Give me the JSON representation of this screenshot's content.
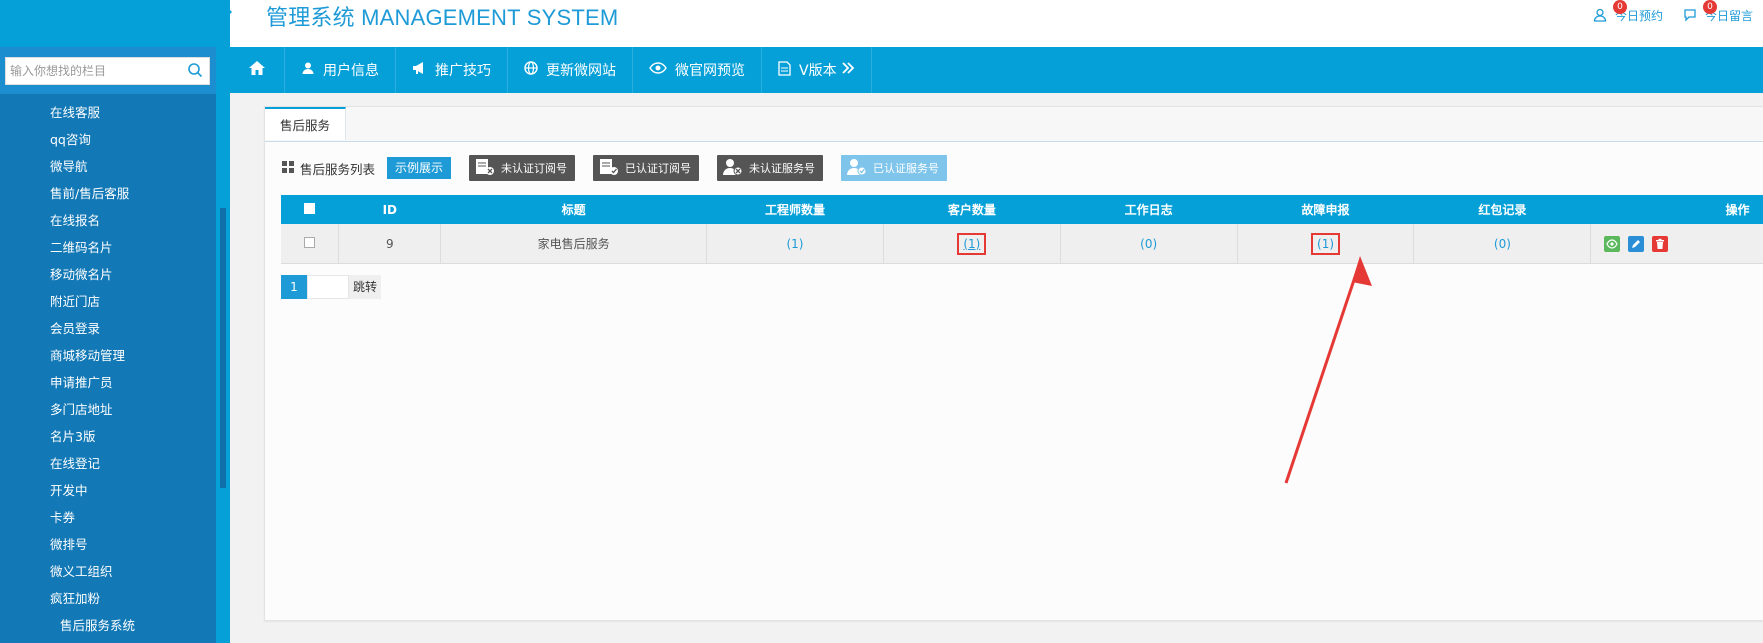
{
  "header": {
    "brand": "管理系统 MANAGEMENT SYSTEM",
    "links": [
      {
        "label": "今日预约",
        "badge": "0"
      },
      {
        "label": "今日留言",
        "badge": "0"
      }
    ]
  },
  "sidebar": {
    "search_placeholder": "输入你想找的栏目",
    "items": [
      {
        "label": "在线客服"
      },
      {
        "label": "qq咨询"
      },
      {
        "label": "微导航"
      },
      {
        "label": "售前/售后客服"
      },
      {
        "label": "在线报名"
      },
      {
        "label": "二维码名片"
      },
      {
        "label": "移动微名片"
      },
      {
        "label": "附近门店"
      },
      {
        "label": "会员登录"
      },
      {
        "label": "商城移动管理"
      },
      {
        "label": "申请推广员"
      },
      {
        "label": "多门店地址"
      },
      {
        "label": "名片3版"
      },
      {
        "label": "在线登记"
      },
      {
        "label": "开发中"
      },
      {
        "label": "卡券"
      },
      {
        "label": "微排号"
      },
      {
        "label": "微义工组织"
      },
      {
        "label": "疯狂加粉"
      }
    ],
    "subitem": "售后服务系统"
  },
  "nav": {
    "items": [
      "用户信息",
      "推广技巧",
      "更新微网站",
      "微官网预览",
      "V版本"
    ]
  },
  "tab": {
    "label": "售后服务"
  },
  "toolbar": {
    "title": "售后服务列表",
    "demo": "示例展示",
    "buttons": [
      "未认证订阅号",
      "已认证订阅号",
      "未认证服务号",
      "已认证服务号"
    ]
  },
  "table": {
    "columns": [
      "ID",
      "标题",
      "工程师数量",
      "客户数量",
      "工作日志",
      "故障申报",
      "红包记录",
      "操作"
    ],
    "rows": [
      {
        "id": "9",
        "title": "家电售后服务",
        "engineers": "(1)",
        "customers": "(1)",
        "logs": "(0)",
        "faults": "(1)",
        "redpacks": "(0)"
      }
    ]
  },
  "pager": {
    "current": "1",
    "go": "跳转"
  },
  "colors": {
    "primary": "#05a0d8",
    "sidebar": "#1278b6",
    "highlight": "#e53935"
  }
}
